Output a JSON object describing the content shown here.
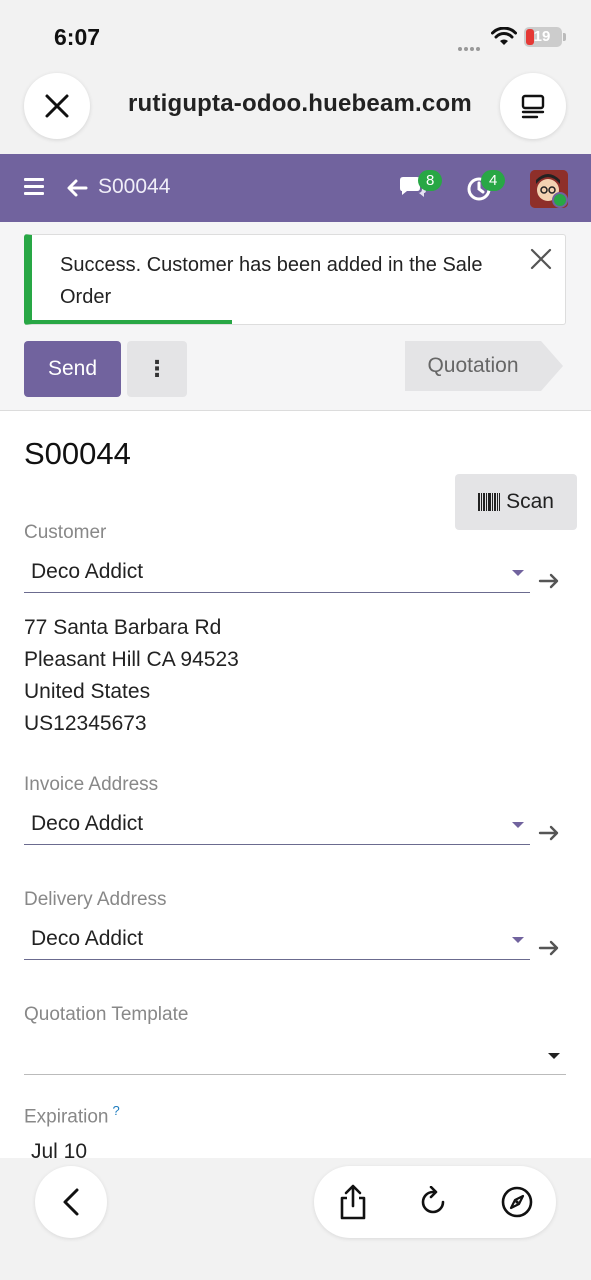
{
  "status_bar": {
    "time": "6:07",
    "battery": "19"
  },
  "browser": {
    "url": "rutigupta-odoo.huebeam.com"
  },
  "navbar": {
    "record_title": "S00044",
    "messages_count": "8",
    "activities_count": "4"
  },
  "notification": {
    "message": "Success. Customer has been added in the Sale Order"
  },
  "control_panel": {
    "send_label": "Send",
    "more_label": "⋮",
    "stage": "Quotation"
  },
  "form": {
    "name": "S00044",
    "scan_label": "Scan",
    "customer": {
      "label": "Customer",
      "value": "Deco Addict",
      "address": [
        "77 Santa Barbara Rd",
        "Pleasant Hill CA 94523",
        "United States",
        "US12345673"
      ]
    },
    "invoice_address": {
      "label": "Invoice Address",
      "value": "Deco Addict"
    },
    "delivery_address": {
      "label": "Delivery Address",
      "value": "Deco Addict"
    },
    "quotation_template": {
      "label": "Quotation Template",
      "value": ""
    },
    "expiration": {
      "label": "Expiration",
      "help": "?",
      "value": "Jul 10"
    }
  },
  "colors": {
    "brand": "#71639e",
    "success": "#28a745"
  }
}
